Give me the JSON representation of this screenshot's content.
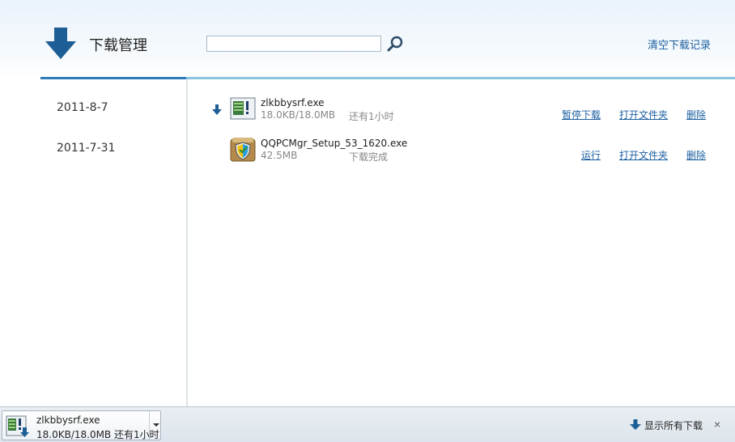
{
  "header": {
    "title": "下载管理",
    "search_value": "",
    "clear_label": "清空下载记录"
  },
  "sidebar": {
    "dates": [
      {
        "label": "2011-8-7"
      },
      {
        "label": "2011-7-31"
      }
    ]
  },
  "downloads": [
    {
      "name": "zlkbbysrf.exe",
      "size": "18.0KB/18.0MB",
      "status": "还有1小时",
      "icon": "exe-file-icon",
      "actions": [
        "暂停下载",
        "打开文件夹",
        "删除"
      ]
    },
    {
      "name": "QQPCMgr_Setup_53_1620.exe",
      "size": "42.5MB",
      "status": "下载完成",
      "icon": "shield-installer-icon",
      "actions": [
        "运行",
        "打开文件夹",
        "删除"
      ]
    }
  ],
  "bottom_bar": {
    "file_name": "zlkbbysrf.exe",
    "file_status": "18.0KB/18.0MB 还有1小时",
    "show_all_label": "显示所有下载",
    "close_glyph": "×"
  },
  "colors": {
    "accent": "#2f7cb8",
    "link": "#1c5fa0",
    "divider_light": "#8cc4e0"
  }
}
